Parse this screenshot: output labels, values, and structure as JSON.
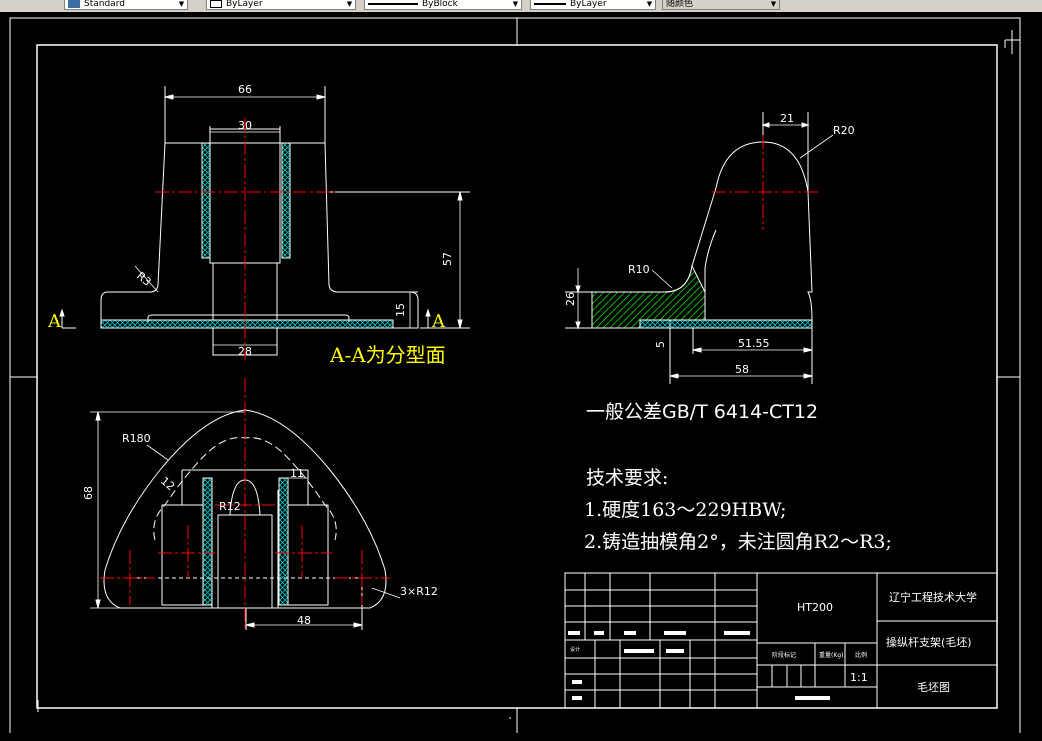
{
  "toolbar": {
    "textstyle": "Standard",
    "layer": "ByLayer",
    "linetype": "ByBlock",
    "lineweight": "ByLayer",
    "color": "随颜色"
  },
  "view_top": {
    "dim_width_outer": "66",
    "dim_width_inner": "30",
    "dim_height": "57",
    "dim_flange": "15",
    "dim_bore": "28",
    "radius": "R3",
    "section_label": "A",
    "parting_note": "A-A为分型面"
  },
  "view_side": {
    "dim_offset": "21",
    "radius_top": "R20",
    "radius_fillet": "R10",
    "dim_height": "26",
    "dim_thickness": "5",
    "dim_length_inner": "51.55",
    "dim_length_outer": "58"
  },
  "view_plan": {
    "radius_outer": "R180",
    "dim_height": "68",
    "dim_wall": "12",
    "dim_slot": "11",
    "radius_slot": "R12",
    "radius_corners": "3×R12",
    "dim_spacing": "48"
  },
  "notes": {
    "tolerance": "一般公差GB/T 6414-CT12",
    "title": "技术要求:",
    "item1": "1.硬度163～229HBW;",
    "item2": "2.铸造抽模角2°，未注圆角R2～R3;"
  },
  "title_block": {
    "material": "HT200",
    "school": "辽宁工程技术大学",
    "part_name": "操纵杆支架(毛坯)",
    "drawing_type": "毛坯图",
    "scale": "1:1",
    "label_stage": "阶段标记",
    "label_weight": "重量(Kg)",
    "label_ratio": "比例",
    "label_design": "设计"
  },
  "colors": {
    "background": "#000000",
    "line": "#ffffff",
    "centerline": "#ff0000",
    "hatch": "#00c8c8",
    "hatch_green": "#00b400",
    "note": "#ffff00"
  }
}
